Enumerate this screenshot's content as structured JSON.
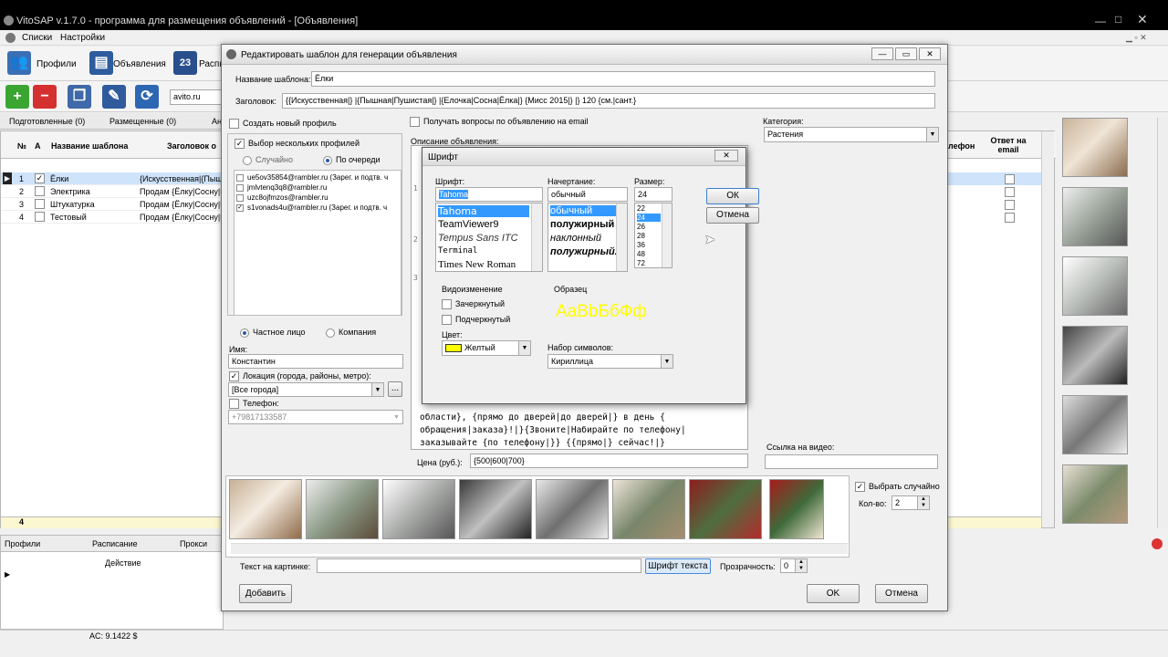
{
  "app": {
    "title": "VitoSAP v.1.7.0 - программа для размещения объявлений  - [Объявления]",
    "menu": [
      "Списки",
      "Настройки"
    ],
    "toolbar": {
      "profiles": "Профили",
      "ads": "Объявления",
      "schedule": "Распи",
      "calendar_day": "23"
    },
    "site_field": "avito.ru",
    "tabs": [
      "Подготовленные (0)",
      "Размещенные (0)"
    ],
    "grid_headers": {
      "num": "№",
      "active": "А",
      "template_name": "Название шаблона",
      "title": "Заголовок о"
    },
    "rows": [
      {
        "num": "1",
        "checked": "✓",
        "name": "Ёлки",
        "title": "{Искусственная|{Пыш"
      },
      {
        "num": "2",
        "checked": "",
        "name": "Электрика",
        "title": "Продам {Ёлку|Сосну|Е"
      },
      {
        "num": "3",
        "checked": "",
        "name": "Штукатурка",
        "title": "Продам {Ёлку|Сосну|Е"
      },
      {
        "num": "4",
        "checked": "",
        "name": "Тестовый",
        "title": "Продам {Ёлку|Сосну|Е"
      }
    ],
    "grid_footer_count": "4",
    "right_headers": {
      "phone": "лефон",
      "email_reply": "Ответ на email"
    },
    "bottom_tabs": [
      "Профили",
      "Расписание",
      "Прокси"
    ],
    "bottom_header": "Действие",
    "status": "AC: 9.1422 $"
  },
  "editor": {
    "title": "Редактировать шаблон для генерации объявления",
    "name_label": "Название шаблона:",
    "name_value": "Ёлки",
    "heading_label": "Заголовок:",
    "heading_value": "{{Искусственная|} |{Пышная|Пушистая|} |{Елочка|Сосна|Ёлка|} {Мисс 2015|} |} 120 {см.|сант.}",
    "create_profile": "Создать новый профиль",
    "get_questions": "Получать вопросы по объявлению на email",
    "category_label": "Категория:",
    "category_value": "Растения",
    "multi_profiles": "Выбор нескольких профилей",
    "random": "Случайно",
    "in_turn": "По очереди",
    "desc_label": "Описание объявления:",
    "profiles": [
      "ue5ov35854@rambler.ru (Зарег. и подтв. ч",
      "jmlvtenq3q8@rambler.ru",
      "uzc8ojfmzos@rambler.ru",
      "s1vonads4u@rambler.ru (Зарег. и подтв. ч"
    ],
    "private": "Частное лицо",
    "company": "Компания",
    "name_field_label": "Имя:",
    "name_field_value": "Константин",
    "location_label": "Локация (города, районы, метро):",
    "location_value": "[Все города]",
    "location_btn": "...",
    "phone_label": "Телефон:",
    "phone_value": "+79817133587",
    "desc_lines": [
      "области}, {прямо до дверей|до дверей|} в день {",
      "обращения|заказа}!|}{Звоните|Набирайте по телефону|",
      "заказывайте {по телефону|}} {{прямо|} сейчас!|}"
    ],
    "desc_gutter": [
      "1",
      "2",
      "3"
    ],
    "video_label": "Ссылка на видео:",
    "price_label": "Цена (руб.):",
    "price_value": "{500|600|700}",
    "random_pick": "Выбрать случайно",
    "count_label": "Кол-во:",
    "count_value": "2",
    "text_on_pic_label": "Текст на картинке:",
    "font_btn": "Шрифт текста",
    "opacity_label": "Прозрачность:",
    "opacity_value": "0",
    "add_btn": "Добавить",
    "ok_btn": "OK",
    "cancel_btn": "Отмена"
  },
  "font_dialog": {
    "title": "Шрифт",
    "font_label": "Шрифт:",
    "font_value": "Tahoma",
    "fonts": [
      "Tahoma",
      "TeamViewer9",
      "Tempus Sans ITC",
      "Terminal",
      "Times New Roman"
    ],
    "style_label": "Начертание:",
    "style_value": "обычный",
    "styles": [
      "обычный",
      "полужирный",
      "наклонный",
      "полужирный..."
    ],
    "size_label": "Размер:",
    "size_value": "24",
    "sizes": [
      "22",
      "24",
      "26",
      "28",
      "36",
      "48",
      "72"
    ],
    "ok": "ОК",
    "cancel": "Отмена",
    "effects_label": "Видоизменение",
    "strike": "Зачеркнутый",
    "underline": "Подчеркнутый",
    "color_label": "Цвет:",
    "color_value": "Желтый",
    "color_swatch": "#ffff00",
    "sample_label": "Образец",
    "sample_text": "AaBbБбФф",
    "charset_label": "Набор символов:",
    "charset_value": "Кириллица"
  }
}
